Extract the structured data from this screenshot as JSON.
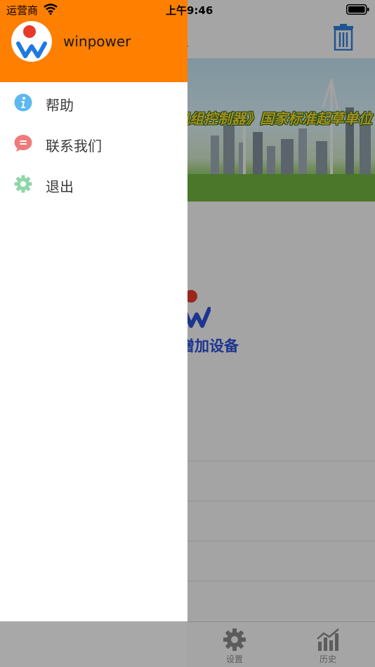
{
  "status_bar": {
    "carrier": "运营商",
    "time": "上午9:46"
  },
  "background": {
    "title_fragment": "点",
    "banner_text": "机组控制器》国家标准起草单位",
    "add_device_fragment": "增加设备",
    "tabs": [
      {
        "label": "设置",
        "icon": "gear-icon"
      },
      {
        "label": "历史",
        "icon": "chart-icon"
      }
    ]
  },
  "drawer": {
    "username": "winpower",
    "items": [
      {
        "label": "帮助",
        "icon": "info-icon",
        "color": "#5bb8f0"
      },
      {
        "label": "联系我们",
        "icon": "chat-bubble-icon",
        "color": "#f07a7a"
      },
      {
        "label": "退出",
        "icon": "gear-icon",
        "color": "#8fd6a8"
      }
    ]
  },
  "colors": {
    "drawer_header": "#ff7f00",
    "accent_blue": "#2a4fd6"
  }
}
